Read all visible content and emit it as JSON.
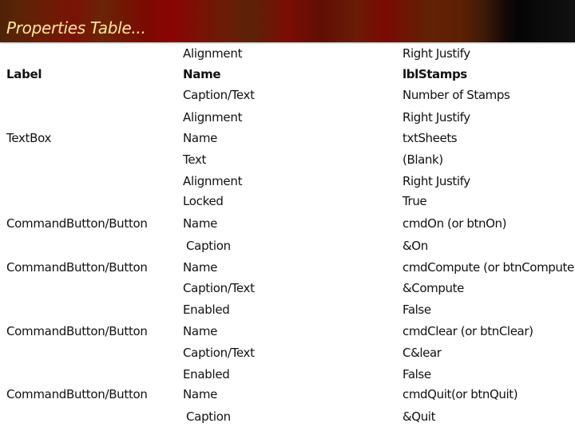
{
  "title": "Properties Table...",
  "rows": [
    {
      "control": "",
      "property": "Alignment",
      "setting": "Right Justify"
    },
    {
      "control": "Label",
      "property": "Name",
      "setting": "lblStamps"
    },
    {
      "control": "",
      "property": "Caption/Text",
      "setting": "Number of Stamps"
    },
    {
      "control": "",
      "property": "Alignment",
      "setting": "Right Justify"
    },
    {
      "control": "TextBox",
      "property": "Name",
      "setting": "txtSheets"
    },
    {
      "control": "",
      "property": "Text",
      "setting": "(Blank)"
    },
    {
      "control": "",
      "property": "Alignment",
      "setting": "Right Justify"
    },
    {
      "control": "",
      "property": "Locked",
      "setting": "True"
    },
    {
      "control": "CommandButton/Button",
      "property": "Name",
      "setting": "cmdOn (or btnOn)"
    },
    {
      "control": "",
      "property": "Caption",
      "setting": "&On"
    },
    {
      "control": "CommandButton/Button",
      "property": "Name",
      "setting": "cmdCompute (or btnCompute)"
    },
    {
      "control": "",
      "property": "Caption/Text",
      "setting": "&Compute"
    },
    {
      "control": "",
      "property": "Enabled",
      "setting": "False"
    },
    {
      "control": "CommandButton/Button",
      "property": "Name",
      "setting": "cmdClear (or btnClear)"
    },
    {
      "control": "",
      "property": "Caption/Text",
      "setting": "C&lear"
    },
    {
      "control": "",
      "property": "Enabled",
      "setting": "False"
    },
    {
      "control": "CommandButton/Button",
      "property": "Name",
      "setting": "cmdQuit(or btnQuit)"
    },
    {
      "control": "",
      "property": "Caption",
      "setting": "&Quit"
    }
  ]
}
